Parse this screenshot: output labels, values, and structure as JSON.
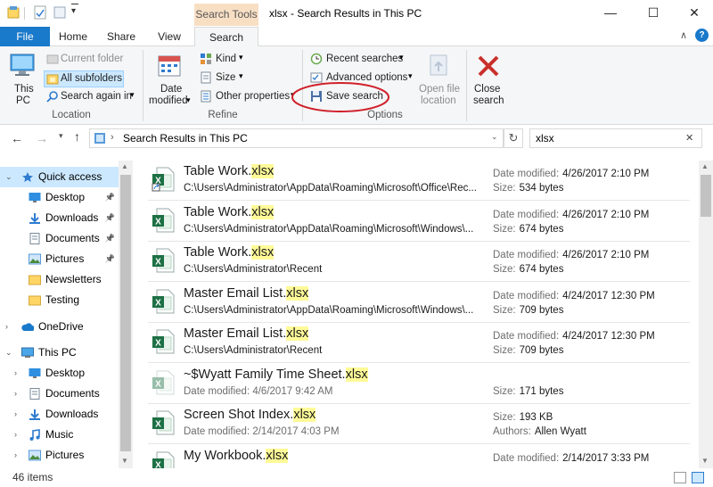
{
  "window": {
    "context_tab": "Search Tools",
    "title": "xlsx - Search Results in This PC",
    "minimize": "—",
    "maximize": "☐",
    "close": "✕",
    "up_chevron": "∧",
    "help": "?"
  },
  "tabs": [
    "File",
    "Home",
    "Share",
    "View",
    "Search"
  ],
  "ribbon": {
    "this_pc": [
      "This",
      "PC"
    ],
    "current_folder": "Current folder",
    "all_subfolders": "All subfolders",
    "search_again_in": "Search again in",
    "location_label": "Location",
    "date_modified": [
      "Date",
      "modified"
    ],
    "kind": "Kind",
    "size": "Size",
    "other_properties": "Other properties",
    "refine_label": "Refine",
    "recent_searches": "Recent searches",
    "advanced_options": "Advanced options",
    "save_search": "Save search",
    "open_file_location": [
      "Open file",
      "location"
    ],
    "options_label": "Options",
    "close_search": [
      "Close",
      "search"
    ]
  },
  "address": {
    "breadcrumb": "Search Results in This PC",
    "search_value": "xlsx"
  },
  "nav": [
    {
      "label": "Quick access",
      "caret": "⌄",
      "icon": "star-icon",
      "level": 0,
      "selected": true,
      "pinned": false
    },
    {
      "label": "Desktop",
      "caret": "",
      "icon": "desktop-icon",
      "level": 1,
      "selected": false,
      "pinned": true
    },
    {
      "label": "Downloads",
      "caret": "",
      "icon": "download-icon",
      "level": 1,
      "selected": false,
      "pinned": true
    },
    {
      "label": "Documents",
      "caret": "",
      "icon": "documents-icon",
      "level": 1,
      "selected": false,
      "pinned": true
    },
    {
      "label": "Pictures",
      "caret": "",
      "icon": "pictures-icon",
      "level": 1,
      "selected": false,
      "pinned": true
    },
    {
      "label": "Newsletters",
      "caret": "",
      "icon": "folder-icon",
      "level": 1,
      "selected": false,
      "pinned": false
    },
    {
      "label": "Testing",
      "caret": "",
      "icon": "folder-icon",
      "level": 1,
      "selected": false,
      "pinned": false
    },
    {
      "label": "OneDrive",
      "caret": "›",
      "icon": "onedrive-icon",
      "level": 0,
      "selected": false,
      "pinned": false
    },
    {
      "label": "This PC",
      "caret": "⌄",
      "icon": "computer-icon",
      "level": 0,
      "selected": false,
      "pinned": false
    },
    {
      "label": "Desktop",
      "caret": "›",
      "icon": "desktop-icon",
      "level": 1,
      "selected": false,
      "pinned": false
    },
    {
      "label": "Documents",
      "caret": "›",
      "icon": "documents-icon",
      "level": 1,
      "selected": false,
      "pinned": false
    },
    {
      "label": "Downloads",
      "caret": "›",
      "icon": "download-icon",
      "level": 1,
      "selected": false,
      "pinned": false
    },
    {
      "label": "Music",
      "caret": "›",
      "icon": "music-icon",
      "level": 1,
      "selected": false,
      "pinned": false
    },
    {
      "label": "Pictures",
      "caret": "›",
      "icon": "pictures-icon",
      "level": 1,
      "selected": false,
      "pinned": false
    }
  ],
  "results": [
    {
      "name": "Table Work.",
      "ext": "xlsx",
      "line2": "C:\\Users\\Administrator\\AppData\\Roaming\\Microsoft\\Office\\Rec...",
      "m1k": "Date modified:",
      "m1v": "4/26/2017 2:10 PM",
      "m2k": "Size:",
      "m2v": "534 bytes",
      "shortcut": true,
      "faded": false
    },
    {
      "name": "Table Work.",
      "ext": "xlsx",
      "line2": "C:\\Users\\Administrator\\AppData\\Roaming\\Microsoft\\Windows\\...",
      "m1k": "Date modified:",
      "m1v": "4/26/2017 2:10 PM",
      "m2k": "Size:",
      "m2v": "674 bytes",
      "shortcut": false,
      "faded": false
    },
    {
      "name": "Table Work.",
      "ext": "xlsx",
      "line2": "C:\\Users\\Administrator\\Recent",
      "m1k": "Date modified:",
      "m1v": "4/26/2017 2:10 PM",
      "m2k": "Size:",
      "m2v": "674 bytes",
      "shortcut": false,
      "faded": false
    },
    {
      "name": "Master Email List.",
      "ext": "xlsx",
      "line2": "C:\\Users\\Administrator\\AppData\\Roaming\\Microsoft\\Windows\\...",
      "m1k": "Date modified:",
      "m1v": "4/24/2017 12:30 PM",
      "m2k": "Size:",
      "m2v": "709 bytes",
      "shortcut": false,
      "faded": false
    },
    {
      "name": "Master Email List.",
      "ext": "xlsx",
      "line2": "C:\\Users\\Administrator\\Recent",
      "m1k": "Date modified:",
      "m1v": "4/24/2017 12:30 PM",
      "m2k": "Size:",
      "m2v": "709 bytes",
      "shortcut": false,
      "faded": false
    },
    {
      "name": "~$Wyatt Family Time Sheet.",
      "ext": "xlsx",
      "line2": "Date modified:  4/6/2017 9:42 AM",
      "m1k": "",
      "m1v": "",
      "m2k": "Size:",
      "m2v": "171 bytes",
      "shortcut": false,
      "faded": true
    },
    {
      "name": "Screen Shot Index.",
      "ext": "xlsx",
      "line2": "Date modified:  2/14/2017 4:03 PM",
      "m1k": "Size:",
      "m1v": "193 KB",
      "m2k": "Authors:",
      "m2v": "Allen Wyatt",
      "shortcut": false,
      "faded": false
    },
    {
      "name": "My Workbook.",
      "ext": "xlsx",
      "line2": "",
      "m1k": "Date modified:",
      "m1v": "2/14/2017 3:33 PM",
      "m2k": "",
      "m2v": "",
      "shortcut": false,
      "faded": false
    }
  ],
  "status": {
    "count": "46 items"
  }
}
